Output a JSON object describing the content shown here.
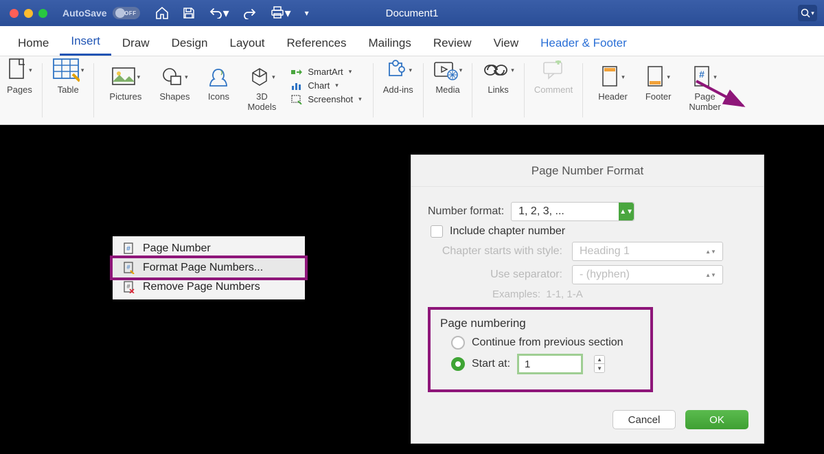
{
  "titlebar": {
    "autosave_label": "AutoSave",
    "autosave_state": "OFF",
    "document_title": "Document1"
  },
  "ribbon_tabs": {
    "home": "Home",
    "insert": "Insert",
    "draw": "Draw",
    "design": "Design",
    "layout": "Layout",
    "references": "References",
    "mailings": "Mailings",
    "review": "Review",
    "view": "View",
    "header_footer": "Header & Footer"
  },
  "ribbon": {
    "pages": "Pages",
    "table": "Table",
    "pictures": "Pictures",
    "shapes": "Shapes",
    "icons": "Icons",
    "models3d": "3D\nModels",
    "smartart": "SmartArt",
    "chart": "Chart",
    "screenshot": "Screenshot",
    "addins": "Add-ins",
    "media": "Media",
    "links": "Links",
    "comment": "Comment",
    "header": "Header",
    "footer": "Footer",
    "page_number": "Page\nNumber"
  },
  "context_menu": {
    "page_number": "Page Number",
    "format": "Format Page Numbers...",
    "remove": "Remove Page Numbers"
  },
  "dialog": {
    "title": "Page Number Format",
    "number_format_label": "Number format:",
    "number_format_value": "1, 2, 3, ...",
    "include_chapter": "Include chapter number",
    "chapter_style_label": "Chapter starts with style:",
    "chapter_style_value": "Heading 1",
    "separator_label": "Use separator:",
    "separator_value": "-    (hyphen)",
    "examples_label": "Examples:",
    "examples_value": "1-1, 1-A",
    "page_numbering": "Page numbering",
    "continue_prev": "Continue from previous section",
    "start_at": "Start at:",
    "start_at_value": "1",
    "cancel": "Cancel",
    "ok": "OK"
  }
}
